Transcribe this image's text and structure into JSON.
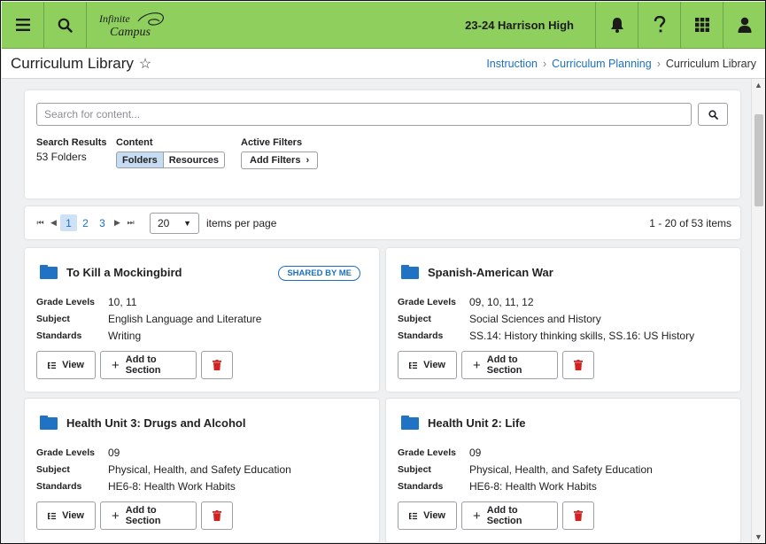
{
  "header": {
    "logo_text_1": "Infinite",
    "logo_text_2": "Campus",
    "school": "23-24 Harrison High",
    "icons": [
      "menu-icon",
      "search-icon",
      "bell-icon",
      "help-icon",
      "apps-grid-icon",
      "user-icon"
    ],
    "accent": "#8fcf5e"
  },
  "title_bar": {
    "title": "Curriculum Library",
    "star": "☆",
    "breadcrumbs": [
      "Instruction",
      "Curriculum Planning",
      "Curriculum Library"
    ]
  },
  "search": {
    "placeholder": "Search for content...",
    "results_label": "Search Results",
    "results_count": "53 Folders",
    "content_label": "Content",
    "content_options": [
      "Folders",
      "Resources"
    ],
    "content_selected": "Folders",
    "filters_label": "Active Filters",
    "add_filters": "Add Filters"
  },
  "pager": {
    "pages": [
      "1",
      "2",
      "3"
    ],
    "current_page": "1",
    "per_page": "20",
    "per_page_label": "items per page",
    "range": "1 - 20 of 53 items"
  },
  "cards": [
    {
      "title": "To Kill a Mockingbird",
      "badge": "SHARED BY ME",
      "grade_levels": "10, 11",
      "subject": "English Language and Literature",
      "standards": "Writing"
    },
    {
      "title": "Spanish-American War",
      "badge": "",
      "grade_levels": "09, 10, 11, 12",
      "subject": "Social Sciences and History",
      "standards": "SS.14: History thinking skills, SS.16: US History"
    },
    {
      "title": "Health Unit 3: Drugs and Alcohol",
      "badge": "",
      "grade_levels": "09",
      "subject": "Physical, Health, and Safety Education",
      "standards": "HE6-8: Health Work Habits"
    },
    {
      "title": "Health Unit 2: Life",
      "badge": "",
      "grade_levels": "09",
      "subject": "Physical, Health, and Safety Education",
      "standards": "HE6-8: Health Work Habits"
    }
  ],
  "labels": {
    "grade_levels": "Grade Levels",
    "subject": "Subject",
    "standards": "Standards",
    "view": "View",
    "add_to_section": "Add to Section"
  }
}
